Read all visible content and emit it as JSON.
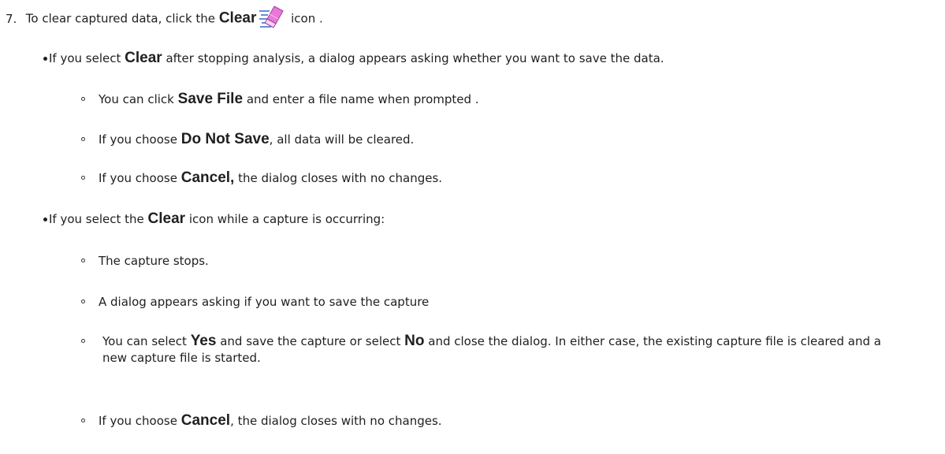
{
  "step": {
    "number": "7.",
    "text_before": "To clear captured data, click the",
    "bold": "Clear",
    "icon": "eraser-clear-icon",
    "text_after": "icon ."
  },
  "bullet1": {
    "text_before": "If you select",
    "bold": "Clear",
    "text_after": " after stopping analysis, a dialog appears asking whether you want to save the data.",
    "sub": [
      {
        "before": "You can click",
        "bold": "Save File",
        "after": "and enter a file name when prompted ."
      },
      {
        "before": "If you choose",
        "bold": "Do Not Save",
        "after": ", all data will be cleared."
      },
      {
        "before": "If you choose",
        "bold": "Cancel,",
        "after": "the dialog closes with no changes."
      }
    ]
  },
  "bullet2": {
    "text_before": "If you select the",
    "bold": "Clear",
    "text_after": " icon while a capture is occurring:",
    "sub": [
      {
        "text": "The capture stops."
      },
      {
        "text": "A dialog appears asking if you want to save the capture"
      },
      {
        "before": "You can select",
        "bold1": "Yes",
        "mid": "and save the capture or select",
        "bold2": "No",
        "after": "and close the dialog.  In either case, the existing capture file is cleared and a new capture file is started."
      },
      {
        "before": "If you choose",
        "bold": "Cancel",
        "after": ", the dialog closes with no changes."
      }
    ]
  }
}
